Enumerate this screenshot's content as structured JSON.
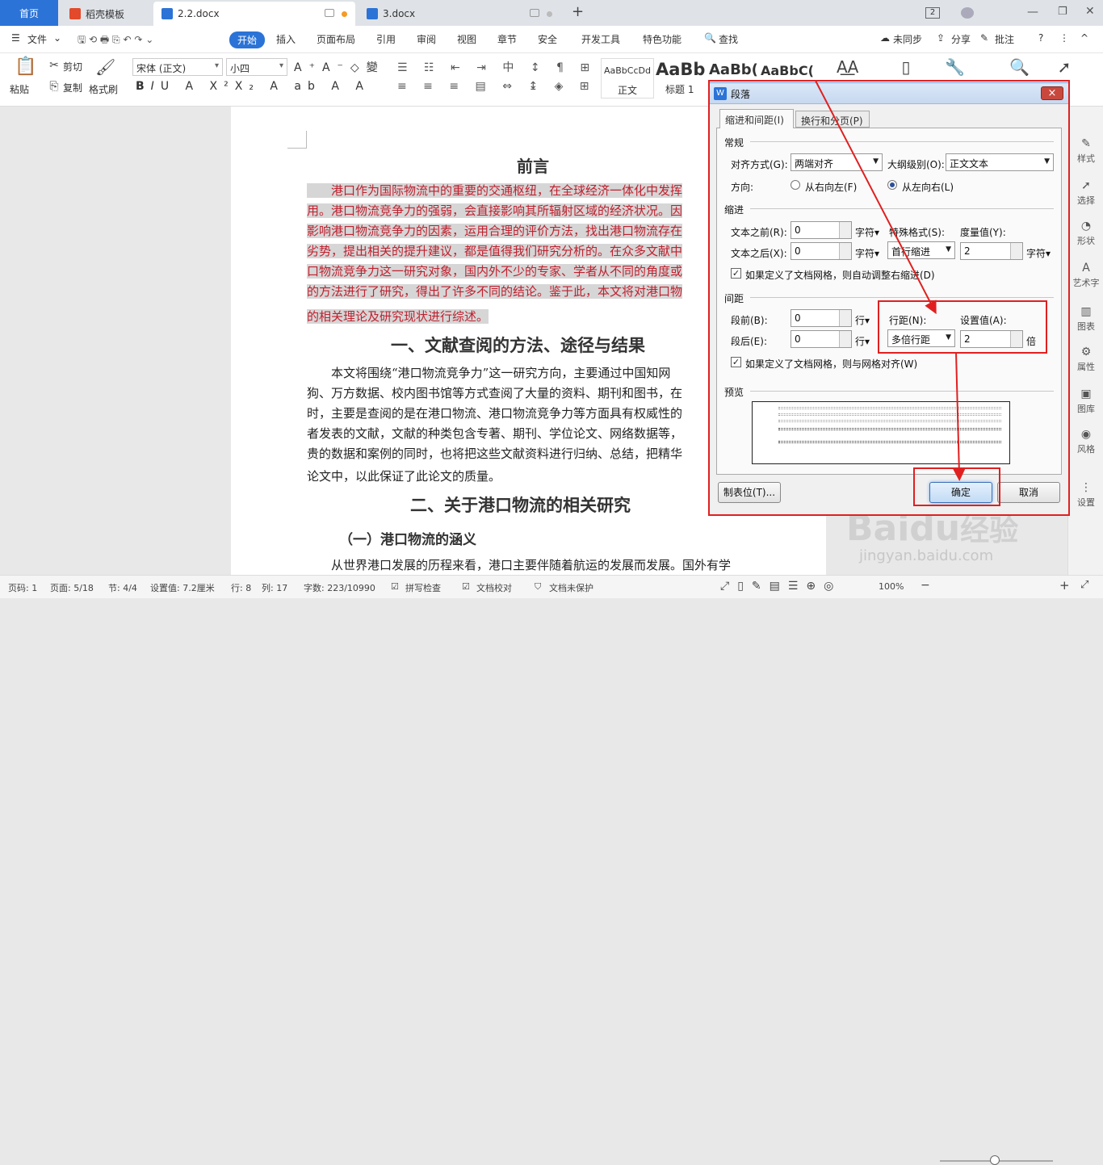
{
  "tabs": {
    "home": "首页",
    "t1": "稻壳模板",
    "t2": "2.2.docx",
    "t3": "3.docx",
    "add": "+",
    "badge": "2"
  },
  "menu": {
    "file": "文件",
    "start": "开始",
    "insert": "插入",
    "layout": "页面布局",
    "ref": "引用",
    "review": "审阅",
    "view": "视图",
    "chapter": "章节",
    "security": "安全",
    "dev": "开发工具",
    "special": "特色功能",
    "find": "查找",
    "sync": "未同步",
    "share": "分享",
    "annot": "批注"
  },
  "ribbon": {
    "paste": "粘贴",
    "cut": "剪切",
    "copy": "复制",
    "formatpainter": "格式刷",
    "font": "宋体 (正文)",
    "size": "小四",
    "style1_sample": "AaBbCcDd",
    "style1": "正文",
    "style2_sample": "AaBb",
    "style2": "标题 1",
    "style3_sample": "AaBb(",
    "style4_sample": "AaBbC("
  },
  "doc": {
    "title": "前言",
    "lines_hl": [
      "　　港口作为国际物流中的重要的交通枢纽，在全球经济一体化中发挥",
      "用。港口物流竞争力的强弱，会直接影响其所辐射区域的经济状况。因",
      "影响港口物流竞争力的因素，运用合理的评价方法，找出港口物流存在",
      "劣势，提出相关的提升建议，都是值得我们研究分析的。在众多文献中",
      "口物流竞争力这一研究对象，国内外不少的专家、学者从不同的角度或",
      "的方法进行了研究，得出了许多不同的结论。鉴于此，本文将对港口物",
      "的相关理论及研究现状进行综述。"
    ],
    "h1": "一、文献查阅的方法、途径与结果",
    "lines_p": [
      "　　本文将围绕“港口物流竞争力”这一研究方向，主要通过中国知网",
      "狗、万方数据、校内图书馆等方式查阅了大量的资料、期刊和图书，在",
      "时，主要是查阅的是在港口物流、港口物流竞争力等方面具有权威性的",
      "者发表的文献，文献的种类包含专著、期刊、学位论文、网络数据等，",
      "贵的数据和案例的同时，也将把这些文献资料进行归纳、总结，把精华",
      "论文中，以此保证了此论文的质量。"
    ],
    "h2": "二、关于港口物流的相关研究",
    "h3": "（一）港口物流的涵义",
    "last": "　　从世界港口发展的历程来看，港口主要伴随着航运的发展而发展。国外有学"
  },
  "sidebar": [
    "样式",
    "选择",
    "形状",
    "艺术字",
    "图表",
    "属性",
    "图库",
    "风格",
    "设置"
  ],
  "status": {
    "page": "页码: 1",
    "pages": "页面: 5/18",
    "section": "节: 4/4",
    "setting": "设置值: 7.2厘米",
    "row": "行: 8",
    "col": "列: 17",
    "words": "字数: 223/10990",
    "spell": "拼写检查",
    "proof": "文档校对",
    "protect": "文档未保护",
    "zoom": "100%"
  },
  "dialog": {
    "title": "段落",
    "tab1": "缩进和间距(I)",
    "tab2": "换行和分页(P)",
    "general": "常规",
    "align_label": "对齐方式(G):",
    "align_value": "两端对齐",
    "outline_label": "大纲级别(O):",
    "outline_value": "正文文本",
    "dir_label": "方向:",
    "rtl": "从右向左(F)",
    "ltr": "从左向右(L)",
    "indent": "缩进",
    "before_text": "文本之前(R):",
    "before_val": "0",
    "after_text": "文本之后(X):",
    "after_val": "0",
    "unit_char": "字符▾",
    "special_label": "特殊格式(S):",
    "special_val": "首行缩进",
    "measure_label": "度量值(Y):",
    "measure_val": "2",
    "grid_indent": "如果定义了文档网格，则自动调整右缩进(D)",
    "spacing": "间距",
    "sp_before": "段前(B):",
    "sp_before_val": "0",
    "sp_after": "段后(E):",
    "sp_after_val": "0",
    "unit_line": "行▾",
    "line_label": "行距(N):",
    "line_val": "多倍行距",
    "set_label": "设置值(A):",
    "set_val": "2",
    "times": "倍",
    "grid_align": "如果定义了文档网格，则与网格对齐(W)",
    "preview": "预览",
    "tabs_btn": "制表位(T)...",
    "ok": "确定",
    "cancel": "取消",
    "close": "×"
  },
  "watermark": {
    "brand": "Baidu",
    "cn": "经验",
    "url": "jingyan.baidu.com"
  }
}
